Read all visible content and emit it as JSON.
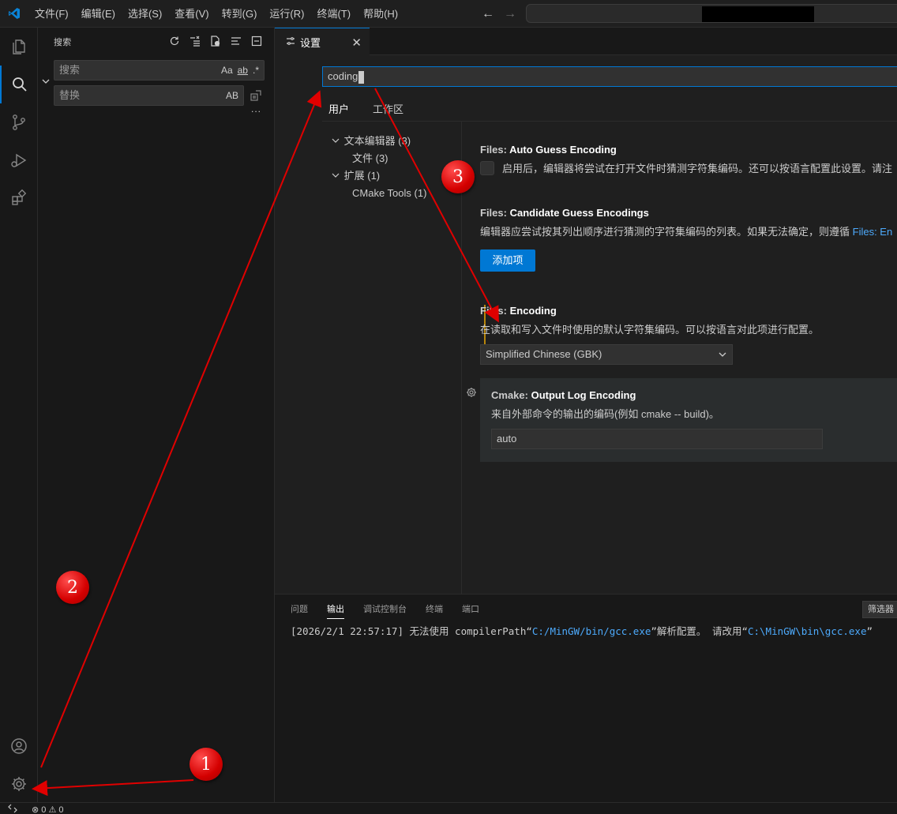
{
  "menu": [
    "文件(F)",
    "编辑(E)",
    "选择(S)",
    "查看(V)",
    "转到(G)",
    "运行(R)",
    "终端(T)",
    "帮助(H)"
  ],
  "nav": {
    "back": "←",
    "forward": "→"
  },
  "sidebar": {
    "title": "搜索",
    "search_placeholder": "搜索",
    "replace_placeholder": "替换",
    "search_opts": [
      "Aa",
      "ab",
      ".*"
    ],
    "replace_opt": "AB",
    "more": "..."
  },
  "tab": {
    "label": "设置",
    "close": "✕"
  },
  "settings": {
    "query": "coding",
    "scopes": [
      "用户",
      "工作区"
    ],
    "toc": [
      "文本编辑器 (3)",
      "文件 (3)",
      "扩展 (1)",
      "CMake Tools (1)"
    ],
    "items": [
      {
        "cat": "Files: ",
        "name": "Auto Guess Encoding",
        "desc": "启用后，编辑器将尝试在打开文件时猜测字符集编码。还可以按语言配置此设置。请注"
      },
      {
        "cat": "Files: ",
        "name": "Candidate Guess Encodings",
        "desc": "编辑器应尝试按其列出顺序进行猜测的字符集编码的列表。如果无法确定，则遵循",
        "link": "Files: En",
        "button": "添加项"
      },
      {
        "cat": "Files: ",
        "name": "Encoding",
        "desc": "在读取和写入文件时使用的默认字符集编码。可以按语言对此项进行配置。",
        "value": "Simplified Chinese (GBK)"
      },
      {
        "cat": "Cmake: ",
        "name": "Output Log Encoding",
        "desc": "来自外部命令的输出的编码(例如 cmake -- build)。",
        "value": "auto"
      }
    ]
  },
  "panel": {
    "tabs": [
      "问题",
      "输出",
      "调试控制台",
      "终端",
      "端口"
    ],
    "active": "输出",
    "filter": "筛选器",
    "line_prefix": "[2026/2/1 22:57:17] 无法使用 compilerPath“",
    "line_path1": "C:/MinGW/bin/gcc.exe",
    "line_mid": "”解析配置。 请改用“",
    "line_path2": "C:\\MinGW\\bin\\gcc.exe",
    "line_end": "”"
  },
  "status": {
    "problems": "⊗ 0 ⚠ 0"
  },
  "annotations": [
    "1",
    "2",
    "3"
  ],
  "colors": {
    "accent": "#0078d4",
    "annotation": "#e00000",
    "modified": "#b8860b"
  }
}
